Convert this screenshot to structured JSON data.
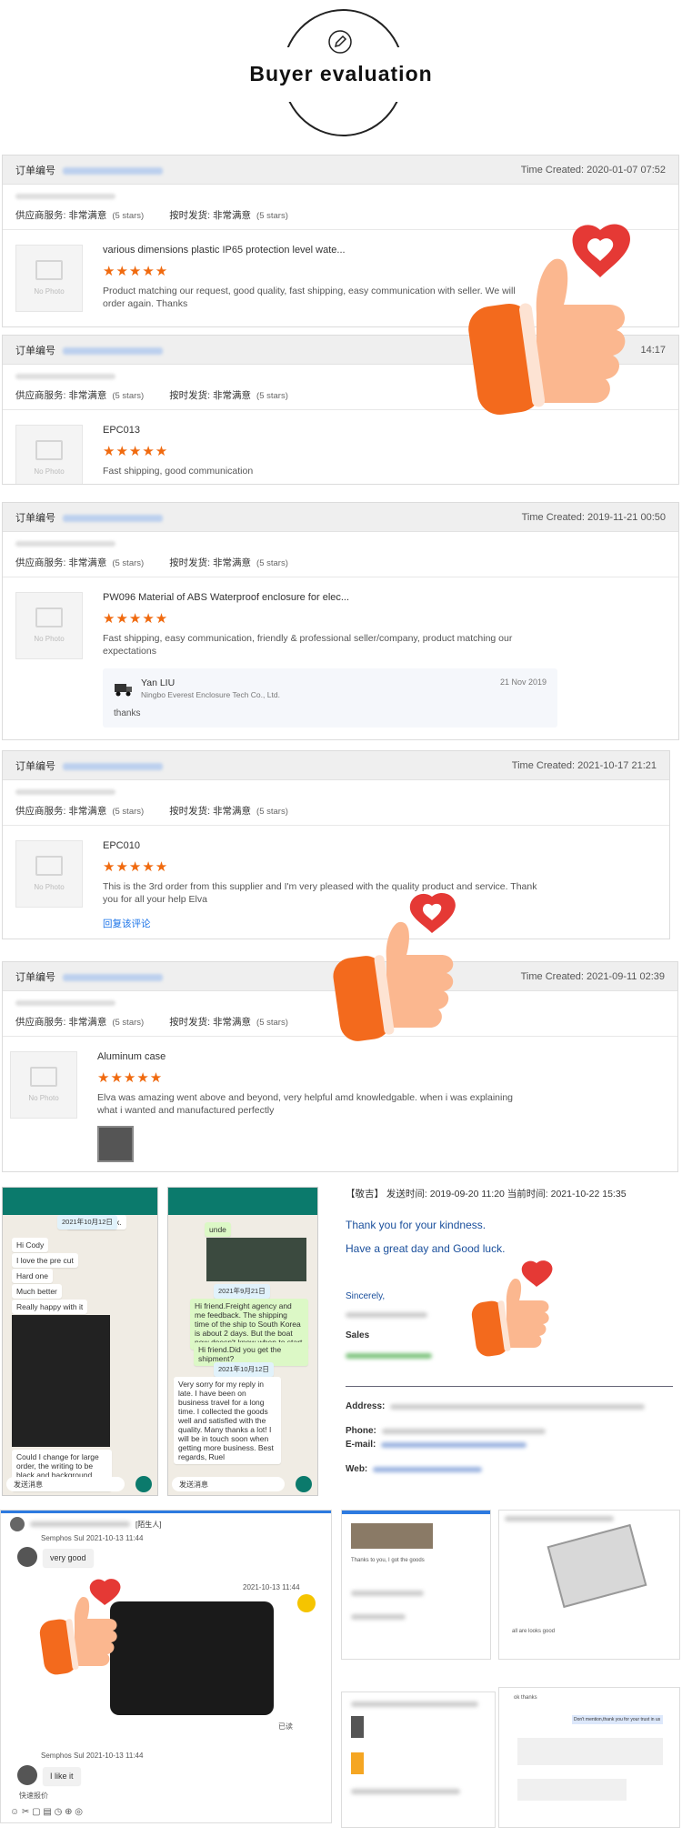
{
  "header": {
    "title": "Buyer evaluation"
  },
  "order_label": "订单编号",
  "service_label": "供应商服务: 非常满意",
  "shipping_label": "按时发货: 非常满意",
  "stars_text": "(5 stars)",
  "no_photo": "No Photo",
  "star_glyphs": "★★★★★",
  "orders": [
    {
      "time": "Time Created: 2020-01-07 07:52",
      "product": "various dimensions plastic IP65 protection level wate...",
      "review": "Product matching our request, good quality, fast shipping, easy communication with seller. We will order again. Thanks"
    },
    {
      "time": "14:17",
      "product": "EPC013",
      "review": "Fast shipping, good communication"
    },
    {
      "time": "Time Created: 2019-11-21 00:50",
      "product": "PW096 Material of ABS Waterproof enclosure for elec...",
      "review": "Fast shipping, easy communication, friendly & professional seller/company, product matching our expectations",
      "reply_name": "Yan LIU",
      "reply_date": "21 Nov 2019",
      "reply_company": "Ningbo Everest Enclosure Tech Co., Ltd.",
      "reply_text": "thanks"
    },
    {
      "time": "Time Created: 2021-10-17 21:21",
      "product": "EPC010",
      "review": "This is the 3rd order from this supplier and I'm very pleased with the quality product and service. Thank you for all your help Elva",
      "link": "回复该评论"
    },
    {
      "time": "Time Created: 2021-09-11 02:39",
      "product": "Aluminum case",
      "review": "Elva was amazing went above and beyond, very helpful amd knowledgable. when i was explaining what i wanted and manufactured perfectly"
    }
  ],
  "chat1": {
    "date": "2021年10月12日",
    "msgs": [
      "your feedback.",
      "Hi Cody",
      "I love the pre cut",
      "Hard one",
      "Much better",
      "Really happy with it",
      "Could I change for large order, the writing to be black and background white?"
    ],
    "input": "发送消息"
  },
  "chat2": {
    "msgs": [
      "unde",
      "Hi friend.Freight agency and me feedback. The shipping time of the ship to South Korea is about 2 days. But the boat now doesn't know when to start",
      "Hi friend.Did you get the shipment?",
      "Very sorry for my reply in late. I have been on business travel for a long time. I collected the goods well and satisfied with the quality. Many thanks a lot! I will be in touch soon when getting more business. Best regards, Ruel"
    ],
    "dates": [
      "2021年9月21日",
      "2021年10月12日"
    ],
    "input": "发送消息"
  },
  "email": {
    "head": "【敬吉】  发送时间: 2019-09-20 11:20  当前时间: 2021-10-22 15:35",
    "line1": "Thank you for your kindness.",
    "line2": "Have a great day and Good luck.",
    "sincerely": "Sincerely,",
    "sales": "Sales",
    "address": "Address:",
    "phone": "Phone:",
    "email": "E-mail:",
    "web": "Web:"
  },
  "chat3": {
    "tag": "[陌生人]",
    "name1": "Semphos Sul",
    "time1": "2021-10-13 11:44",
    "msg1": "very good",
    "time_mid": "2021-10-13 11:44",
    "read": "已读",
    "time2": "2021-10-13 11:44",
    "msg2": "I like it",
    "bottom": "快速报价"
  },
  "mini": {
    "a1": "Thanks to you, I got the goods",
    "b1": "all are looks good",
    "c1": "Don't mention,thank you for your trust in us",
    "c2": "ok thanks"
  },
  "colors": {
    "star": "#f06a0f",
    "wa_green": "#0b7a6c",
    "link": "#1a73e8",
    "email_blue": "#1a4f9c"
  }
}
